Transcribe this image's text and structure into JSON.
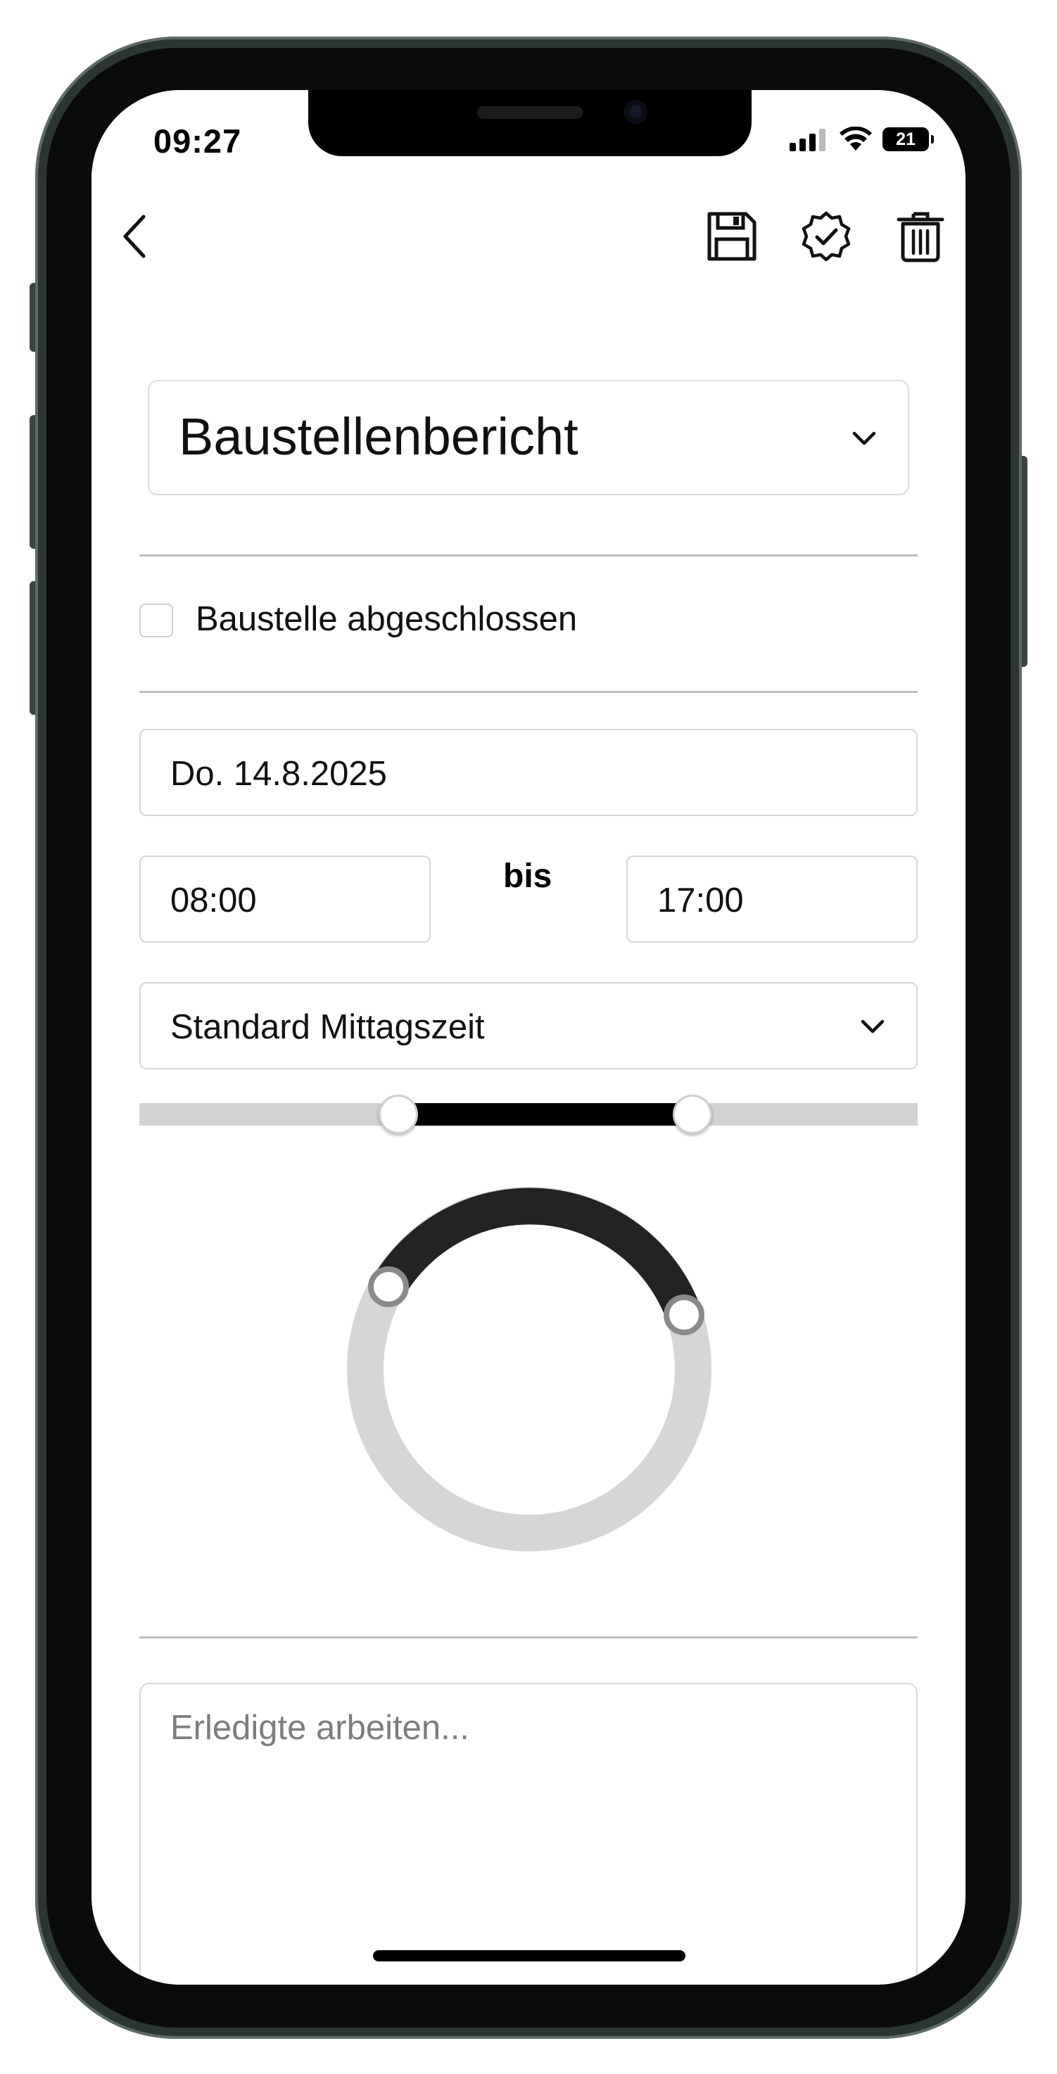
{
  "status_bar": {
    "time": "09:27",
    "battery": "21"
  },
  "toolbar": {
    "back_icon": "chevron-left-icon",
    "save_icon": "floppy-disk-icon",
    "approve_icon": "badge-check-icon",
    "delete_icon": "trash-icon"
  },
  "report_type": {
    "selected": "Baustellenbericht"
  },
  "site_closed": {
    "label": "Baustelle abgeschlossen",
    "checked": false
  },
  "date_field": {
    "value": "Do. 14.8.2025"
  },
  "time_range": {
    "start": "08:00",
    "separator": "bis",
    "end": "17:00"
  },
  "lunch": {
    "selected": "Standard Mittagszeit"
  },
  "notes": {
    "placeholder": "Erledigte arbeiten..."
  },
  "colors": {
    "accent": "#000000",
    "track": "#d3d3d3",
    "ring_active": "#222222"
  }
}
